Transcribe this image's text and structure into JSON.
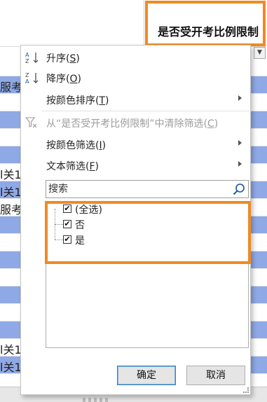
{
  "sheet": {
    "column_header": "是否受开考比例限制",
    "filter_button_glyph": "▼",
    "row_fragments": [
      {
        "row": 1,
        "text": "服考"
      },
      {
        "row": 6,
        "text": "l关1"
      },
      {
        "row": 7,
        "text": "l关1"
      },
      {
        "row": 8,
        "text": "服考"
      },
      {
        "row": 16,
        "text": "l关1"
      },
      {
        "row": 17,
        "text": "l关1"
      }
    ]
  },
  "menu": {
    "sort_asc": {
      "label": "升序(",
      "key": "S",
      "end": ")",
      "icon": "sort-ascending-icon"
    },
    "sort_desc": {
      "label": "降序(",
      "key": "O",
      "end": ")",
      "icon": "sort-descending-icon"
    },
    "sort_color": {
      "label": "按颜色排序(",
      "key": "T",
      "end": ")"
    },
    "clear_filter": {
      "label": "从“是否受开考比例限制”中清除筛选(",
      "key": "C",
      "end": ")",
      "icon": "clear-filter-icon"
    },
    "filter_color": {
      "label": "按颜色筛选(",
      "key": "I",
      "end": ")"
    },
    "text_filter": {
      "label": "文本筛选(",
      "key": "F",
      "end": ")"
    },
    "search": {
      "placeholder": "搜索",
      "icon": "magnifier-icon"
    },
    "checklist": [
      {
        "label": "(全选)",
        "checked": true
      },
      {
        "label": "否",
        "checked": true
      },
      {
        "label": "是",
        "checked": true
      }
    ],
    "ok_label": "确定",
    "cancel_label": "取消"
  },
  "colors": {
    "highlight": "#f08a24",
    "band_blue": "#8fa9e6"
  }
}
